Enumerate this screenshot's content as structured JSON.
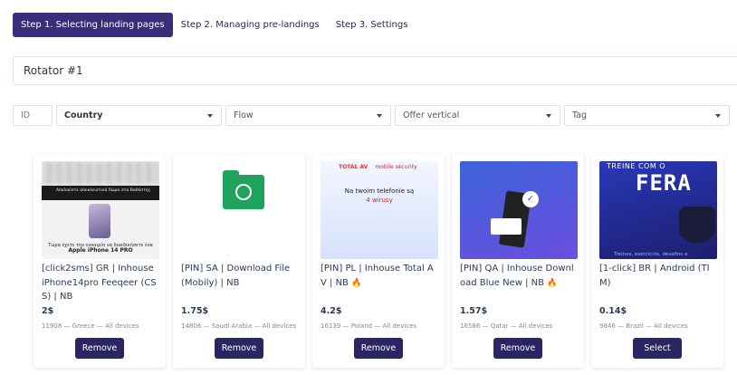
{
  "steps": [
    {
      "label": "Step 1. Selecting landing pages",
      "active": true
    },
    {
      "label": "Step 2. Managing pre-landings",
      "active": false
    },
    {
      "label": "Step 3. Settings",
      "active": false
    }
  ],
  "rotator": {
    "value": "Rotator #1"
  },
  "filters": {
    "id_placeholder": "ID",
    "country": "Country",
    "flow": "Flow",
    "offer_vertical": "Offer vertical",
    "tag": "Tag"
  },
  "cards": [
    {
      "title": "[click2sms] GR | Inhouse iPhone14pro Feeqeer (CSS) | NB",
      "price": "2$",
      "meta": "11908 — Greece — All devices",
      "button": "Remove",
      "thumb": {
        "banner": "Απολαύστε αποκλειστικά δώρα στα Βαθύστης",
        "text": "Τώρα έχετε την ευκαιρία να διεκδικήσετε ένα",
        "bottom": "Apple iPhone 14 PRO"
      }
    },
    {
      "title": "[PIN] SA | Download File (Mobily) | NB",
      "price": "1.75$",
      "meta": "14806 — Saudi Arabia — All devices",
      "button": "Remove",
      "thumb": {
        "icon": "folder-download-icon",
        "bottom": "..."
      }
    },
    {
      "title": "[PIN] PL | Inhouse Total AV | NB",
      "price": "4.2$",
      "meta": "16139 — Poland — All devices",
      "button": "Remove",
      "thumb": {
        "brand_a": "TOTAL AV",
        "brand_b": "mobile security",
        "line1": "Na twoim telefonie są",
        "line2": "4 wirusy"
      }
    },
    {
      "title": "[PIN] QA | Inhouse Download Blue New | NB",
      "price": "1.57$",
      "meta": "16586 — Qatar — All devices",
      "button": "Remove",
      "thumb": {
        "icon": "check-icon"
      }
    },
    {
      "title": "[1-click] BR | Android (TIM)",
      "price": "0.14$",
      "meta": "9846 — Brazil — All devices",
      "button": "Select",
      "thumb": {
        "line1": "TREINE COM O",
        "line2": "FERA",
        "caption": "Treinos, exercícios, desafios e"
      }
    }
  ],
  "colors": {
    "accent": "#3a2d7a",
    "button": "#2b2563",
    "flame": "#f39a18"
  }
}
